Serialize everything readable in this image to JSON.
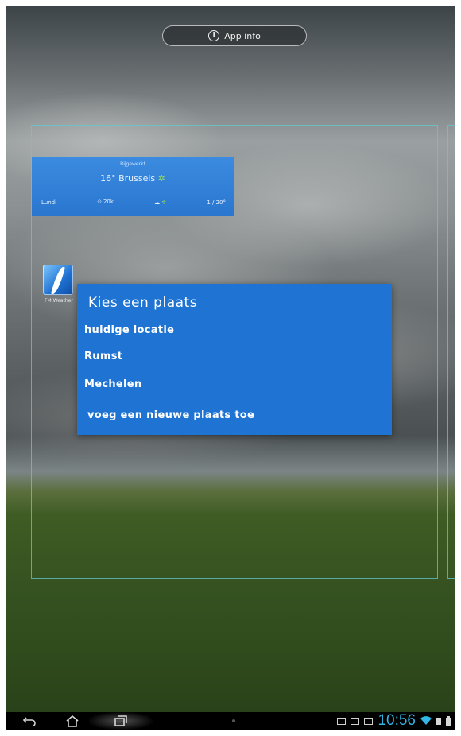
{
  "top_bar": {
    "app_info_label": "App info",
    "info_icon": "info-circle-icon"
  },
  "weather_widget": {
    "updated_text": "Bijgewerkt",
    "temperature": "16°",
    "city": "Brussels",
    "day": "Lundi",
    "wind": "20k",
    "forecast_icon": "partly-cloudy-icon",
    "sun_icon": "sun-icon",
    "extra": "1 / 20°"
  },
  "app_icon": {
    "label": "FM Weather",
    "icon": "weather-app-icon"
  },
  "place_menu": {
    "title": "Kies een plaats",
    "items": [
      {
        "label": "huidige locatie"
      },
      {
        "label": "Rumst"
      },
      {
        "label": "Mechelen"
      },
      {
        "label": "voeg een nieuwe plaats toe"
      }
    ]
  },
  "nav_bar": {
    "back_icon": "back-icon",
    "home_icon": "home-icon",
    "recent_apps_icon": "recent-apps-icon",
    "clock": "10:56",
    "status_icons": [
      "gallery-icon",
      "notification-icon",
      "camera-icon",
      "wifi-icon",
      "battery-icon"
    ]
  },
  "colors": {
    "menu_bg": "#1f73d2",
    "widget_bg": "#2a76cf",
    "clock": "#33b5e5",
    "frame": "#64c8d2"
  }
}
